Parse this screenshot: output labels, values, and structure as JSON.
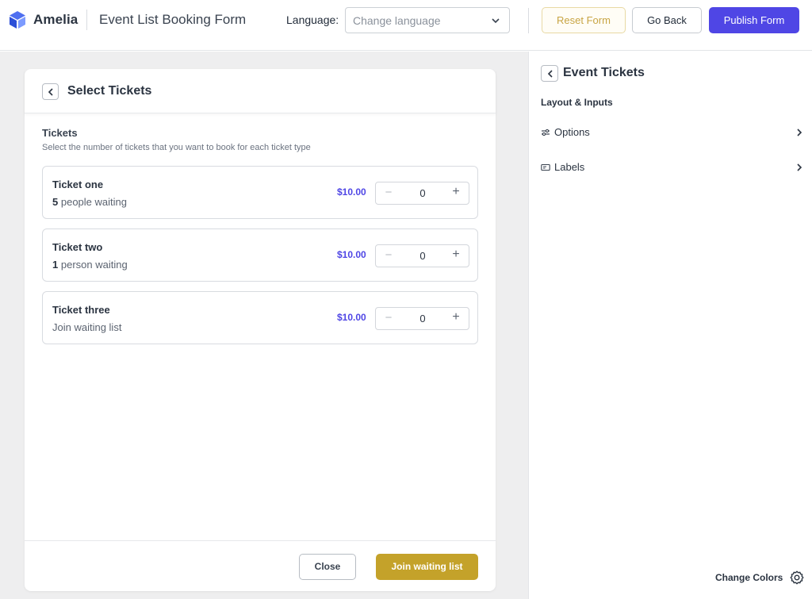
{
  "header": {
    "brand": "Amelia",
    "title": "Event List Booking Form",
    "language_label": "Language:",
    "language_placeholder": "Change language",
    "reset_label": "Reset Form",
    "back_label": "Go Back",
    "publish_label": "Publish Form"
  },
  "form": {
    "title": "Select Tickets",
    "section_title": "Tickets",
    "section_subtitle": "Select the number of tickets that you want to book for each ticket type",
    "tickets": [
      {
        "name": "Ticket one",
        "count": "5",
        "waiting_text": "people waiting",
        "price": "$10.00",
        "qty": "0"
      },
      {
        "name": "Ticket two",
        "count": "1",
        "waiting_text": "person waiting",
        "price": "$10.00",
        "qty": "0"
      },
      {
        "name": "Ticket three",
        "count": "",
        "waiting_text": "Join waiting list",
        "price": "$10.00",
        "qty": "0"
      }
    ],
    "close_label": "Close",
    "join_label": "Join waiting list"
  },
  "panel": {
    "title": "Event Tickets",
    "section": "Layout & Inputs",
    "items": [
      {
        "label": "Options",
        "icon": "sliders-icon"
      },
      {
        "label": "Labels",
        "icon": "label-tag-icon"
      }
    ],
    "change_colors_label": "Change Colors"
  },
  "colors": {
    "accent": "#4f46e5",
    "gold": "#c4a22a",
    "price": "#4f46e5"
  }
}
